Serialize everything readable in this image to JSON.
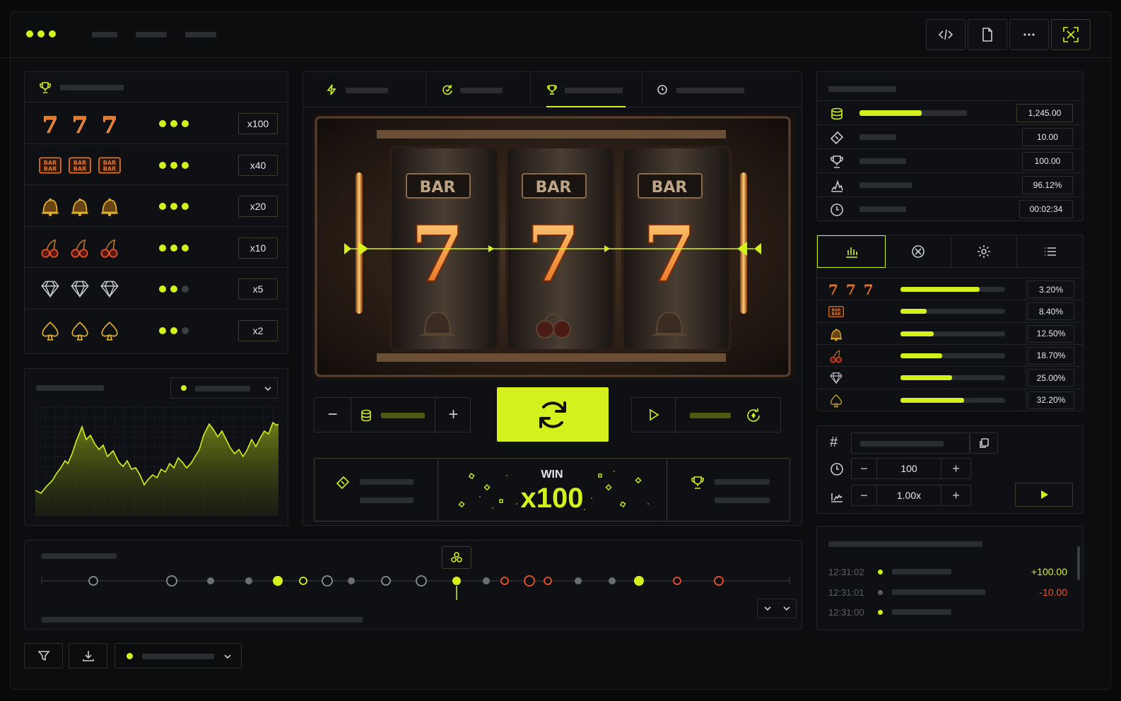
{
  "topbar": {
    "icons": [
      "code-icon",
      "file-icon",
      "more-icon",
      "fullscreen-icon"
    ]
  },
  "paytable": {
    "rows": [
      {
        "symbol": "seven",
        "label": "7",
        "dots": 3,
        "multiplier": "x100"
      },
      {
        "symbol": "bar",
        "label": "BAR BAR",
        "dots": 3,
        "multiplier": "x40"
      },
      {
        "symbol": "bell",
        "dots": 3,
        "multiplier": "x20"
      },
      {
        "symbol": "cherry",
        "dots": 3,
        "multiplier": "x10"
      },
      {
        "symbol": "diamond",
        "dots": 2,
        "multiplier": "x5"
      },
      {
        "symbol": "spade",
        "dots": 2,
        "multiplier": "x2"
      }
    ]
  },
  "reels": {
    "bar_label": "BAR",
    "center_label": "7"
  },
  "win": {
    "label": "WIN",
    "value": "x100"
  },
  "stats": {
    "balance": "1,245.00",
    "bet": "10.00",
    "win": "100.00",
    "rtp": "96.12%",
    "time": "00:02:34",
    "balance_fill": 0.58
  },
  "probabilities": [
    {
      "symbol": "seven",
      "label": "7 7 7",
      "value": "3.20%",
      "fill": 0.76
    },
    {
      "symbol": "bar",
      "label": "BAR BAR",
      "value": "8.40%",
      "fill": 0.25
    },
    {
      "symbol": "bell",
      "value": "12.50%",
      "fill": 0.32
    },
    {
      "symbol": "cherry",
      "value": "18.70%",
      "fill": 0.4
    },
    {
      "symbol": "diamond",
      "value": "25.00%",
      "fill": 0.49
    },
    {
      "symbol": "spade",
      "value": "32.20%",
      "fill": 0.61
    }
  ],
  "autoplay": {
    "hash_symbol": "#",
    "spins": "100",
    "multiplier": "1.00x"
  },
  "history": [
    {
      "time": "12:31:02",
      "amount": "+100.00",
      "status": "win"
    },
    {
      "time": "12:31:01",
      "amount": "-10.00",
      "status": "loss"
    },
    {
      "time": "12:31:00",
      "amount": "",
      "status": "neutral"
    }
  ],
  "colors": {
    "accent": "#d5f11d",
    "loss": "#f2522e",
    "panel": "#0e1013",
    "border": "#22262b"
  }
}
